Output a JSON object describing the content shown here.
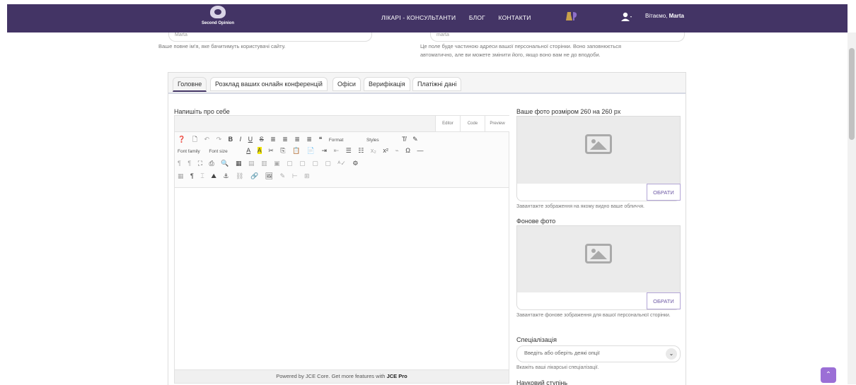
{
  "header": {
    "logo_text": "Second Opinion",
    "nav": [
      "ЛІКАРІ - КОНСУЛЬТАНТИ",
      "БЛОГ",
      "КОНТАКТИ"
    ],
    "greeting_prefix": "Вітаємо,",
    "greeting_name": "Marta",
    "bg_color": "#433465"
  },
  "profile": {
    "name_value": "Marta",
    "alias_value": "marta",
    "name_hint": "Ваше повне ім'я, яке бачитимуть користувачі сайту.",
    "alias_hint_1": "Це поле буде частиною адреси вашої персональної сторінки. Воно заповнюється",
    "alias_hint_2": "автоматично, але ви можете змінити його, якщо воно вам не до вподоби."
  },
  "tabs": [
    "Головне",
    "Розклад ваших онлайн конференцій",
    "Офіси",
    "Верифікація",
    "Платіжні дані"
  ],
  "about": {
    "label": "Напишіть про себе",
    "editor_tabs": [
      "Editor",
      "Code",
      "Preview"
    ],
    "dropdowns": {
      "format": "Format",
      "styles": "Styles",
      "font_family": "Font family",
      "font_size": "Font size"
    },
    "footer_prefix": "Powered by JCE Core. Get more features with",
    "footer_brand": "JCE Pro"
  },
  "photo": {
    "label": "Ваше фото розміром 260 на 260 px",
    "button": "ОБРАТИ",
    "hint": "Завантажте зображення на якому видно ваше обличчя."
  },
  "background": {
    "label": "Фонове фото",
    "button": "ОБРАТИ",
    "hint": "Завантажте фонове зображення для вашої персональної сторінки."
  },
  "specialization": {
    "label": "Спеціалізація",
    "placeholder": "Введіть або оберіть деякі опції",
    "hint": "Вкажіть ваші лікарські спеціалізації.",
    "next_label": "Науковий ступінь"
  }
}
